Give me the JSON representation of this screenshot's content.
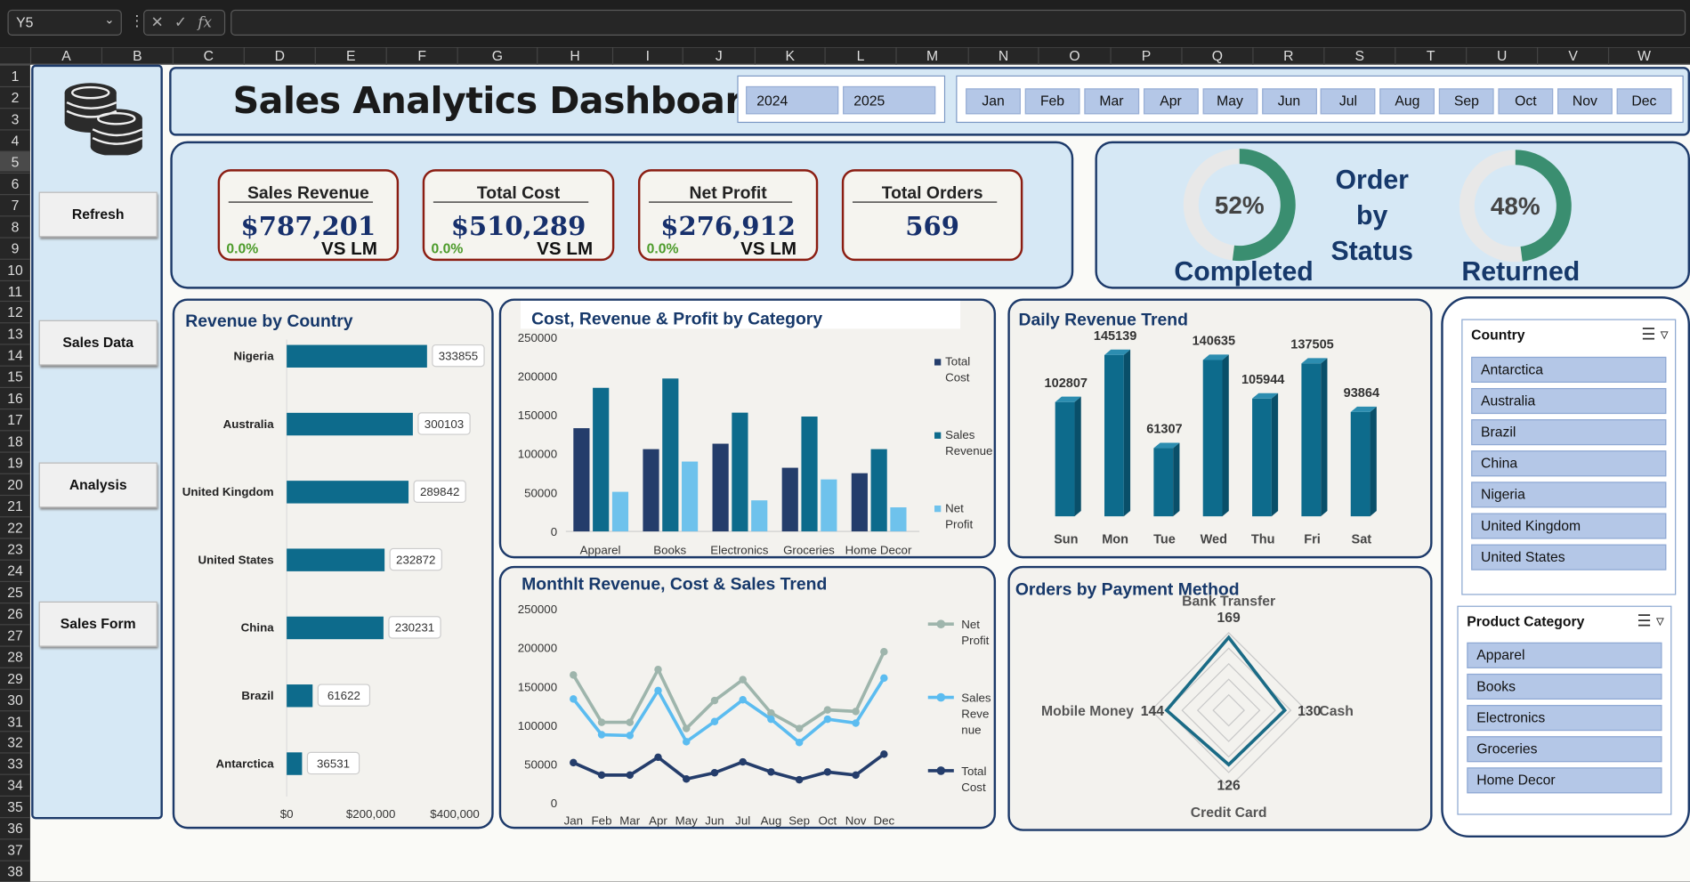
{
  "formula_bar": {
    "cell_ref": "Y5",
    "fx": "fx",
    "cancel": "✕",
    "enter": "✓"
  },
  "columns": [
    "A",
    "B",
    "C",
    "D",
    "E",
    "F",
    "G",
    "H",
    "I",
    "J",
    "K",
    "L",
    "M",
    "N",
    "O",
    "P",
    "Q",
    "R",
    "S",
    "T",
    "U",
    "V",
    "W"
  ],
  "rows": [
    "1",
    "2",
    "3",
    "4",
    "5",
    "6",
    "7",
    "8",
    "9",
    "10",
    "11",
    "12",
    "13",
    "14",
    "15",
    "16",
    "17",
    "18",
    "19",
    "20",
    "21",
    "22",
    "23",
    "24",
    "25",
    "26",
    "27",
    "28",
    "29",
    "30",
    "31",
    "32",
    "33",
    "34",
    "35",
    "36",
    "37",
    "38"
  ],
  "sidebar": {
    "buttons": [
      "Refresh",
      "Sales Data",
      "Analysis",
      "Sales Form"
    ]
  },
  "header": {
    "title": "Sales Analytics Dashboard",
    "years": [
      "2024",
      "2025"
    ],
    "months": [
      "Jan",
      "Feb",
      "Mar",
      "Apr",
      "May",
      "Jun",
      "Jul",
      "Aug",
      "Sep",
      "Oct",
      "Nov",
      "Dec"
    ]
  },
  "kpis": [
    {
      "label": "Sales Revenue",
      "value": "$787,201",
      "change": "0.0%",
      "compare": "VS LM"
    },
    {
      "label": "Total Cost",
      "value": "$510,289",
      "change": "0.0%",
      "compare": "VS LM"
    },
    {
      "label": "Net Profit",
      "value": "$276,912",
      "change": "0.0%",
      "compare": "VS LM"
    },
    {
      "label": "Total Orders",
      "value": "569"
    }
  ],
  "order_status": {
    "title_line1": "Order",
    "title_line2": "by",
    "title_line3": "Status",
    "completed_pct": "52%",
    "completed_label": "Completed",
    "completed_value": 0.52,
    "returned_pct": "48%",
    "returned_label": "Returned",
    "returned_value": 0.48
  },
  "colors": {
    "dark_navy": "#243d6b",
    "teal": "#0d6b8c",
    "light_blue": "#6ec2ec",
    "line_grey": "#9eb5ac",
    "line_lightblue": "#5bbcf0",
    "line_navy": "#243d6b",
    "ring_green": "#3a8e70"
  },
  "slicers": {
    "country": {
      "title": "Country",
      "items": [
        "Antarctica",
        "Australia",
        "Brazil",
        "China",
        "Nigeria",
        "United Kingdom",
        "United States"
      ]
    },
    "category": {
      "title": "Product Category",
      "items": [
        "Apparel",
        "Books",
        "Electronics",
        "Groceries",
        "Home Decor"
      ]
    }
  },
  "chart_data": [
    {
      "id": "revenue_by_country",
      "type": "bar",
      "orientation": "horizontal",
      "title": "Revenue by Country",
      "categories": [
        "Nigeria",
        "Australia",
        "United Kingdom",
        "United States",
        "China",
        "Brazil",
        "Antarctica"
      ],
      "values": [
        333855,
        300103,
        289842,
        232872,
        230231,
        61622,
        36531
      ],
      "xlim": [
        0,
        500000
      ],
      "xticks": [
        "$0",
        "$200,000",
        "$400,000"
      ]
    },
    {
      "id": "category_breakdown",
      "type": "bar",
      "title": "Cost, Revenue & Profit by Category",
      "categories": [
        "Apparel",
        "Books",
        "Electronics",
        "Groceries",
        "Home Decor"
      ],
      "series": [
        {
          "name": "Total Cost",
          "values": [
            133000,
            106000,
            113000,
            82000,
            75000
          ]
        },
        {
          "name": "Sales Revenue",
          "values": [
            185000,
            197000,
            153000,
            148000,
            106000
          ]
        },
        {
          "name": "Net Profit",
          "values": [
            51000,
            90000,
            40000,
            67000,
            31000
          ]
        }
      ],
      "ylim": [
        0,
        250000
      ],
      "yticks": [
        "250000",
        "200000",
        "150000",
        "100000",
        "50000",
        "0"
      ]
    },
    {
      "id": "daily_revenue",
      "type": "bar",
      "title": "Daily Revenue Trend",
      "categories": [
        "Sun",
        "Mon",
        "Tue",
        "Wed",
        "Thu",
        "Fri",
        "Sat"
      ],
      "values": [
        102807,
        145139,
        61307,
        140635,
        105944,
        137505,
        93864
      ],
      "ylim": [
        0,
        160000
      ]
    },
    {
      "id": "monthly_trend",
      "type": "line",
      "title": "Monthlt Revenue, Cost & Sales Trend",
      "categories": [
        "Jan",
        "Feb",
        "Mar",
        "Apr",
        "May",
        "Jun",
        "Jul",
        "Aug",
        "Sep",
        "Oct",
        "Nov",
        "Dec"
      ],
      "series": [
        {
          "name": "Net Profit",
          "values": [
            165000,
            104000,
            104000,
            172000,
            96000,
            132000,
            159000,
            116000,
            96000,
            120000,
            118000,
            195000
          ]
        },
        {
          "name": "Sales Revenue",
          "values": [
            134000,
            88000,
            87000,
            145000,
            79000,
            105000,
            133000,
            108000,
            78000,
            108000,
            103000,
            161000
          ]
        },
        {
          "name": "Total Cost",
          "values": [
            52000,
            36000,
            36000,
            59000,
            31000,
            39000,
            53000,
            40000,
            30000,
            40000,
            36000,
            63000
          ]
        }
      ],
      "ylim": [
        0,
        250000
      ],
      "yticks": [
        "250000",
        "200000",
        "150000",
        "100000",
        "50000",
        "0"
      ],
      "legend_labels": [
        [
          "Net",
          "Profit"
        ],
        [
          "Sales",
          "Reve",
          "nue"
        ],
        [
          "Total",
          "Cost"
        ]
      ]
    },
    {
      "id": "payment_method",
      "type": "radar",
      "title": "Orders by Payment Method",
      "categories": [
        "Bank Transfer",
        "Cash",
        "Credit Card",
        "Mobile Money"
      ],
      "values": [
        169,
        130,
        126,
        144
      ]
    }
  ]
}
